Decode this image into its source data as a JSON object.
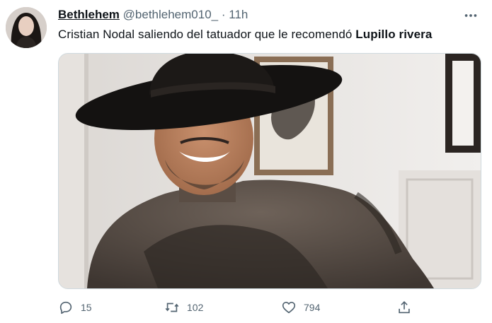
{
  "tweet": {
    "author_name": "Bethlehem",
    "author_handle": "@bethlehem010_",
    "separator": "·",
    "time": "11h",
    "text_main": "Cristian Nodal saliendo del tatuador que le recomendó ",
    "text_bold": "Lupillo rivera",
    "actions": {
      "reply_count": "15",
      "retweet_count": "102",
      "like_count": "794"
    }
  },
  "icons": {
    "more": "more-horizontal-icon",
    "reply": "reply-icon",
    "retweet": "retweet-icon",
    "like": "heart-icon",
    "share": "share-icon"
  }
}
